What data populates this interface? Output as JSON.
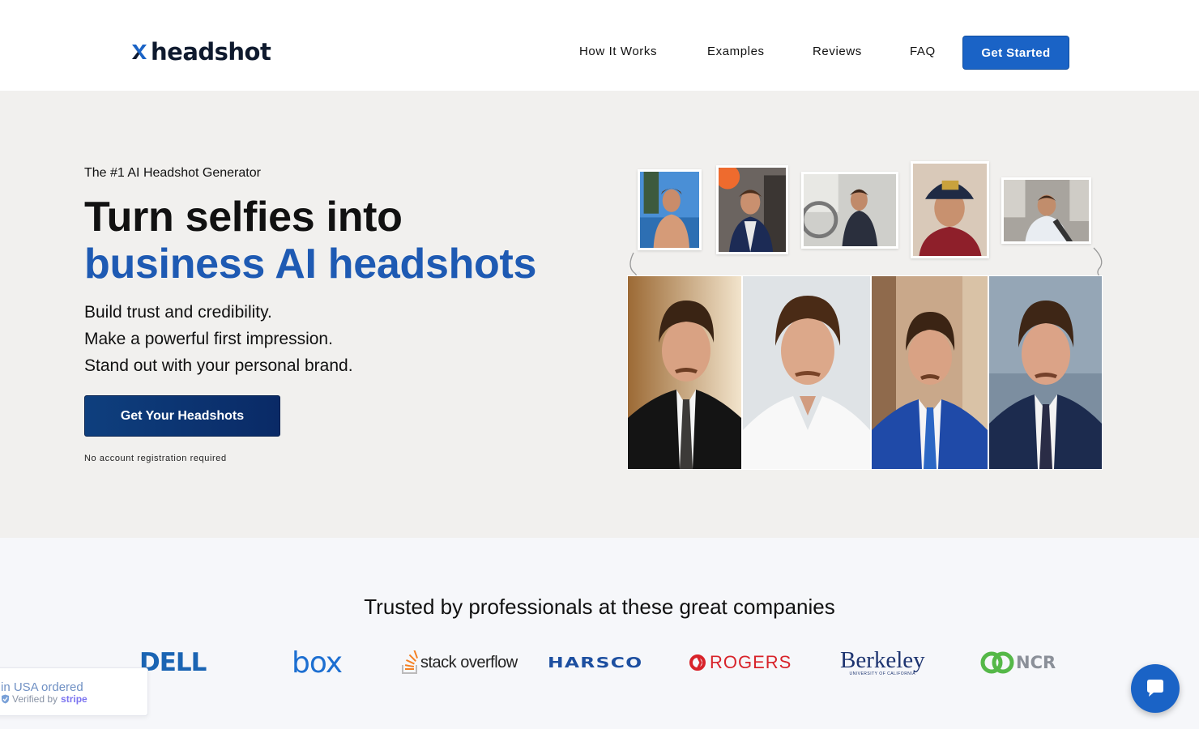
{
  "header": {
    "logo_text": "headshot",
    "nav": [
      "How It Works",
      "Examples",
      "Reviews",
      "FAQ"
    ],
    "cta_label": "Get Started"
  },
  "hero": {
    "eyebrow": "The #1 AI Headshot Generator",
    "title_line1": "Turn selfies into",
    "title_line2": "business AI headshots",
    "subtitle_lines": [
      "Build trust and credibility.",
      "Make a powerful first impression.",
      "Stand out with your personal brand."
    ],
    "cta_label": "Get Your Headshots",
    "note": "No account registration required"
  },
  "trusted": {
    "heading": "Trusted by professionals at these great companies",
    "companies": [
      "DELL",
      "box",
      "stack overflow",
      "HARSCO",
      "ROGERS",
      "Berkeley",
      "UNIVERSITY OF CALIFORNIA",
      "NCR"
    ]
  },
  "badge": {
    "main_text": "in USA ordered",
    "verified_text": "Verified by",
    "stripe_text": "stripe"
  },
  "colors": {
    "brand_blue": "#1a63c6",
    "title_blue": "#1e5ab3",
    "cta_navy": "#0e3f7e",
    "hero_bg": "#f1f0ee"
  },
  "icons": [
    "headshot-logo-icon",
    "chat-bubble-icon",
    "shield-check-icon"
  ]
}
